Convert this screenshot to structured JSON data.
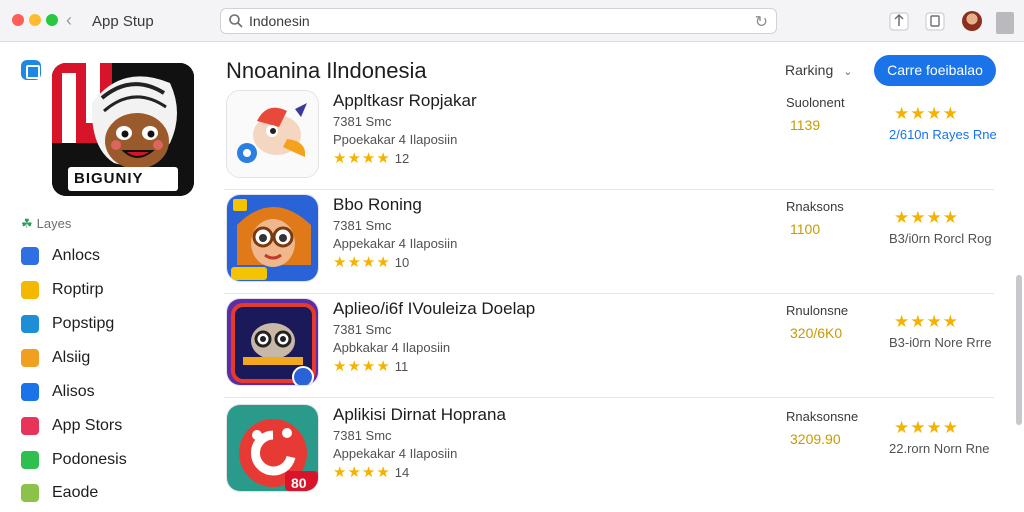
{
  "window": {
    "title": "App Stup",
    "search_value": "Indonesin",
    "search_placeholder": "Indonesin"
  },
  "sidebar": {
    "section_label": "Layes",
    "items": [
      {
        "label": "Anlocs",
        "color": "#2f6fe4"
      },
      {
        "label": "Roptirp",
        "color": "#f5b800"
      },
      {
        "label": "Popstipg",
        "color": "#1e8fd6"
      },
      {
        "label": "Alsiig",
        "color": "#f0a020"
      },
      {
        "label": "Alisos",
        "color": "#1a73e8"
      },
      {
        "label": "App Stors",
        "color": "#e8335a"
      },
      {
        "label": "Podonesis",
        "color": "#2fbf4e"
      },
      {
        "label": "Eaode",
        "color": "#8bc34a"
      }
    ]
  },
  "main": {
    "title": "Nnoanina Ilndonesia",
    "sort_label": "Rarking",
    "cta_label": "Carre foeibalao",
    "apps": [
      {
        "name": "Appltkasr Ropjakar",
        "size": "7381 Smc",
        "developer": "Ppoekakar  4 Ilaposiin",
        "stars": "★★★★",
        "rating_count": "12",
        "meta_label": "Suolonent",
        "meta_value": "1139",
        "right_stars": "★★★★",
        "right_text": "2/610n Rayes Rne",
        "right_link": true,
        "icon_theme": "bird"
      },
      {
        "name": "Bbo Roning",
        "size": "7381 Smc",
        "developer": "Appekakar  4 Ilaposiin",
        "stars": "★★★★",
        "rating_count": "10",
        "meta_label": "Rnaksons",
        "meta_value": "1100",
        "right_stars": "★★★★",
        "right_text": "B3/i0rn Rorcl Rog",
        "right_link": false,
        "icon_theme": "girl"
      },
      {
        "name": "Aplieo/i6f IVouleiza Doelap",
        "size": "7381 Smc",
        "developer": "Apbkakar  4 Ilaposiin",
        "stars": "★★★★",
        "rating_count": "11",
        "meta_label": "Rnulonsne",
        "meta_value": "320/6K0",
        "right_stars": "★★★★",
        "right_text": "B3-i0rn Nore Rrre",
        "right_link": false,
        "icon_theme": "robot"
      },
      {
        "name": "Aplikisi Dirnat Hoprana",
        "size": "7381 Smc",
        "developer": "Appekakar  4 Ilaposiin",
        "stars": "★★★★",
        "rating_count": "14",
        "meta_label": "Rnaksonsne",
        "meta_value": "3209.90",
        "right_stars": "★★★★",
        "right_text": "22.rorn Norn Rne",
        "right_link": false,
        "icon_theme": "red",
        "icon_badge": "80"
      }
    ]
  },
  "featured": {
    "banner_text": "BIGUNIY"
  }
}
